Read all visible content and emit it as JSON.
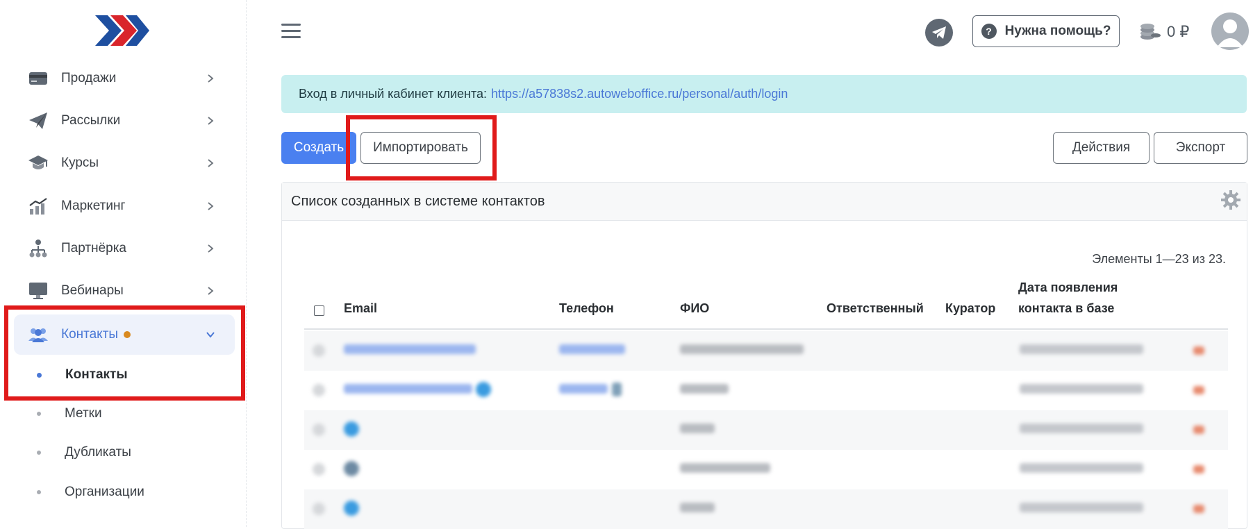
{
  "sidebar": {
    "items": [
      {
        "label": "Продажи",
        "icon": "credit-card-icon"
      },
      {
        "label": "Рассылки",
        "icon": "paper-plane-icon"
      },
      {
        "label": "Курсы",
        "icon": "graduation-cap-icon"
      },
      {
        "label": "Маркетинг",
        "icon": "chart-icon"
      },
      {
        "label": "Партнёрка",
        "icon": "hierarchy-icon"
      },
      {
        "label": "Вебинары",
        "icon": "monitor-icon"
      },
      {
        "label": "Контакты",
        "icon": "users-icon"
      }
    ],
    "subitems": [
      {
        "label": "Контакты"
      },
      {
        "label": "Метки"
      },
      {
        "label": "Дубликаты"
      },
      {
        "label": "Организации"
      }
    ]
  },
  "header": {
    "help_label": "Нужна помощь?",
    "balance": "0 ₽"
  },
  "alert": {
    "text": "Вход в личный кабинет клиента:",
    "link": "https://a57838s2.autowebofﬁce.ru/personal/auth/login"
  },
  "toolbar": {
    "create_label": "Создать",
    "import_label": "Импортировать",
    "actions_label": "Действия",
    "export_label": "Экспорт"
  },
  "card": {
    "title": "Список созданных в системе контактов",
    "count_text": "Элементы 1—23 из 23."
  },
  "table": {
    "columns": {
      "email": "Email",
      "phone": "Телефон",
      "name": "ФИО",
      "responsible": "Ответственный",
      "curator": "Куратор",
      "date_line1": "Дата появления",
      "date_line2": "контакта в базе"
    }
  },
  "colors": {
    "accent": "#4a80f0",
    "alert_bg": "#c8eff0",
    "highlight": "#e01a1a",
    "active_nav_bg": "#eef2fb"
  }
}
